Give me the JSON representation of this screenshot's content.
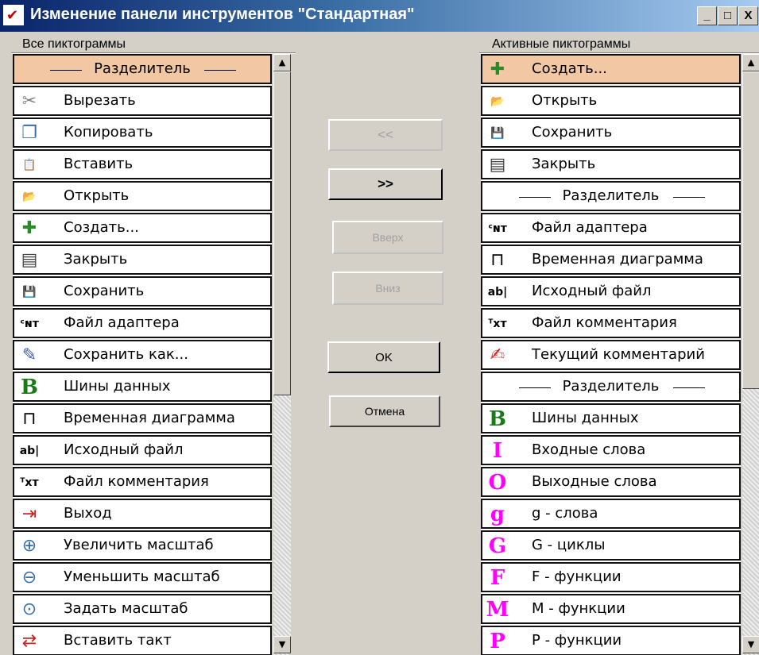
{
  "window": {
    "title": "Изменение панели инструментов \"Стандартная\"",
    "controls": [
      "_",
      "□",
      "X"
    ]
  },
  "left": {
    "group_label": "Все пиктограммы",
    "items": [
      {
        "label": "Разделитель",
        "icon": "separator",
        "separator": true,
        "selected": true
      },
      {
        "label": "Вырезать",
        "icon": "scissors-icon",
        "glyph": "✂",
        "color": "#808080"
      },
      {
        "label": "Копировать",
        "icon": "copy-icon",
        "glyph": "❐",
        "color": "#3a6ea5"
      },
      {
        "label": "Вставить",
        "icon": "paste-icon",
        "glyph": "📋",
        "color": "#b08030"
      },
      {
        "label": "Открыть",
        "icon": "open-folder-icon",
        "glyph": "📂",
        "color": "#d89a2a"
      },
      {
        "label": "Создать...",
        "icon": "new-file-icon",
        "glyph": "✚",
        "color": "#2a8a2a"
      },
      {
        "label": "Закрыть",
        "icon": "close-file-icon",
        "glyph": "▤",
        "color": "#404040"
      },
      {
        "label": "Сохранить",
        "icon": "save-icon",
        "glyph": "💾",
        "color": "#3a5fa5"
      },
      {
        "label": "Файл адаптера",
        "icon": "adapter-file-icon",
        "glyph": "ᶜɴᴛ",
        "color": "#000000"
      },
      {
        "label": "Сохранить как...",
        "icon": "save-as-icon",
        "glyph": "✎",
        "color": "#3a5fa5"
      },
      {
        "label": "Шины данных",
        "icon": "data-bus-icon",
        "glyph": "B",
        "color": "#1a7a1a"
      },
      {
        "label": "Временная диаграмма",
        "icon": "timing-diagram-icon",
        "glyph": "⊓",
        "color": "#000000"
      },
      {
        "label": "Исходный файл",
        "icon": "source-file-icon",
        "glyph": "ab|",
        "color": "#000000"
      },
      {
        "label": "Файл комментария",
        "icon": "comment-file-icon",
        "glyph": "ᵀxᴛ",
        "color": "#000000"
      },
      {
        "label": "Выход",
        "icon": "exit-icon",
        "glyph": "⇥",
        "color": "#cc2222"
      },
      {
        "label": "Увеличить масштаб",
        "icon": "zoom-in-icon",
        "glyph": "⊕",
        "color": "#3a6ea5"
      },
      {
        "label": "Уменьшить масштаб",
        "icon": "zoom-out-icon",
        "glyph": "⊖",
        "color": "#3a6ea5"
      },
      {
        "label": "Задать масштаб",
        "icon": "zoom-set-icon",
        "glyph": "⊙",
        "color": "#3a6ea5"
      },
      {
        "label": "Вставить такт",
        "icon": "insert-tact-icon",
        "glyph": "⇄",
        "color": "#cc2222"
      }
    ]
  },
  "right": {
    "group_label": "Активные пиктограммы",
    "items": [
      {
        "label": "Создать...",
        "icon": "new-file-icon",
        "glyph": "✚",
        "color": "#2a8a2a",
        "selected": true
      },
      {
        "label": "Открыть",
        "icon": "open-folder-icon",
        "glyph": "📂",
        "color": "#d89a2a"
      },
      {
        "label": "Сохранить",
        "icon": "save-icon",
        "glyph": "💾",
        "color": "#3a5fa5"
      },
      {
        "label": "Закрыть",
        "icon": "close-file-icon",
        "glyph": "▤",
        "color": "#404040"
      },
      {
        "label": "Разделитель",
        "icon": "separator",
        "separator": true
      },
      {
        "label": "Файл адаптера",
        "icon": "adapter-file-icon",
        "glyph": "ᶜɴᴛ",
        "color": "#000000"
      },
      {
        "label": "Временная диаграмма",
        "icon": "timing-diagram-icon",
        "glyph": "⊓",
        "color": "#000000"
      },
      {
        "label": "Исходный файл",
        "icon": "source-file-icon",
        "glyph": "ab|",
        "color": "#000000"
      },
      {
        "label": "Файл комментария",
        "icon": "comment-file-icon",
        "glyph": "ᵀxᴛ",
        "color": "#000000"
      },
      {
        "label": "Текущий комментарий",
        "icon": "current-comment-icon",
        "glyph": "✍",
        "color": "#cc2222"
      },
      {
        "label": "Разделитель",
        "icon": "separator",
        "separator": true
      },
      {
        "label": "Шины данных",
        "icon": "data-bus-icon",
        "glyph": "B",
        "color": "#1a7a1a"
      },
      {
        "label": "Входные слова",
        "icon": "input-words-icon",
        "glyph": "I",
        "color": "#ff00ff"
      },
      {
        "label": "Выходные слова",
        "icon": "output-words-icon",
        "glyph": "O",
        "color": "#ff00ff"
      },
      {
        "label": "g - слова",
        "icon": "g-words-icon",
        "glyph": "g",
        "color": "#ff00ff"
      },
      {
        "label": "G - циклы",
        "icon": "g-cycles-icon",
        "glyph": "G",
        "color": "#ff00ff"
      },
      {
        "label": "F - функции",
        "icon": "f-functions-icon",
        "glyph": "F",
        "color": "#ff00ff"
      },
      {
        "label": "M - функции",
        "icon": "m-functions-icon",
        "glyph": "M",
        "color": "#ff00ff"
      },
      {
        "label": "P - функции",
        "icon": "p-functions-icon",
        "glyph": "P",
        "color": "#ff00ff"
      }
    ]
  },
  "buttons": {
    "remove": {
      "label": "<<",
      "enabled": false
    },
    "add": {
      "label": ">>",
      "enabled": true
    },
    "up": {
      "label": "Вверх",
      "enabled": false
    },
    "down": {
      "label": "Вниз",
      "enabled": false
    },
    "ok": {
      "label": "OK",
      "enabled": true
    },
    "cancel": {
      "label": "Отмена",
      "enabled": true
    }
  },
  "colors": {
    "selection": "#f2c8a4",
    "title_start": "#0a246a",
    "title_end": "#a6caf0"
  }
}
